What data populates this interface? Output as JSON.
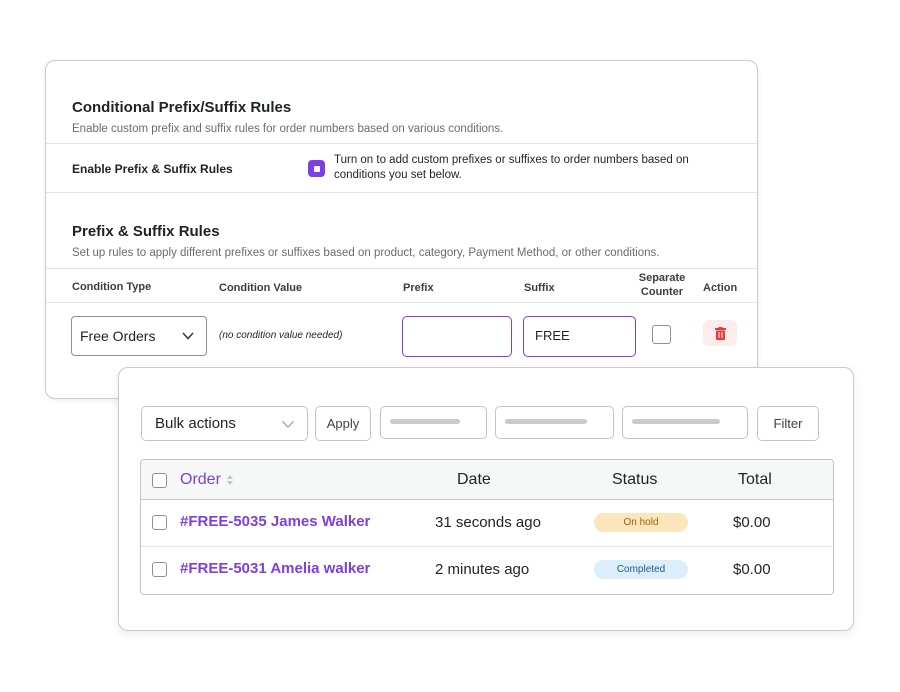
{
  "settings": {
    "title": "Conditional Prefix/Suffix Rules",
    "subtitle": "Enable custom prefix and suffix rules for order numbers based on various conditions.",
    "enable_label": "Enable Prefix & Suffix Rules",
    "enable_checked": true,
    "enable_description": "Turn on to add custom prefixes or suffixes to order numbers based on conditions you set below.",
    "rules_title": "Prefix & Suffix Rules",
    "rules_subtitle": "Set up rules to apply different prefixes or suffixes based on product, category, Payment Method, or other conditions.",
    "columns": {
      "condition_type": "Condition Type",
      "condition_value": "Condition Value",
      "prefix": "Prefix",
      "suffix": "Suffix",
      "separate_counter_line1": "Separate",
      "separate_counter_line2": "Counter",
      "action": "Action"
    },
    "rule": {
      "condition_type": "Free Orders",
      "condition_value_note": "(no condition value needed)",
      "prefix": "",
      "suffix": "FREE",
      "separate_counter": false
    },
    "icons": {
      "dropdown": "chevron-down-icon",
      "delete": "trash-icon"
    },
    "accent_color": "#7b3fe4",
    "danger_color": "#e23b3b"
  },
  "orders": {
    "bulk_actions_label": "Bulk actions",
    "apply_label": "Apply",
    "filter_label": "Filter",
    "headers": {
      "order": "Order",
      "date": "Date",
      "status": "Status",
      "total": "Total"
    },
    "rows": [
      {
        "order": "#FREE-5035 James Walker",
        "date": "31 seconds ago",
        "status": "On hold",
        "total": "$0.00"
      },
      {
        "order": "#FREE-5031 Amelia walker",
        "date": "2 minutes ago",
        "status": "Completed",
        "total": "$0.00"
      }
    ],
    "status_colors": {
      "on_hold_bg": "#fbe5bb",
      "completed_bg": "#dceefb"
    }
  }
}
